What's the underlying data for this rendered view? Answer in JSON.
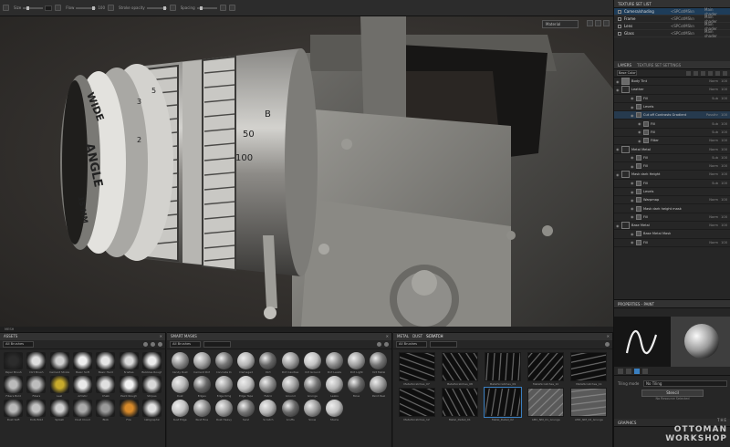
{
  "toolbar": {
    "labels": [
      "Size",
      "Flow",
      "Stroke opacity",
      "Spacing"
    ],
    "values": [
      "1",
      "100",
      "100",
      "1"
    ]
  },
  "viewport": {
    "camera_mode": "Material",
    "status_label": "MESH",
    "lens_engraving_1": "WIDE",
    "lens_engraving_2": "ANGLE",
    "lens_engraving_3": "15 MM",
    "focus_numbers": [
      "2",
      "3",
      "5",
      "B",
      "50",
      "100"
    ]
  },
  "texture_set_list": {
    "title": "TEXTURE SET LIST",
    "rows": [
      {
        "name": "Camera/shading",
        "shader": "<SPCotMSkn",
        "uv": "Main shader",
        "selected": true
      },
      {
        "name": "Frame",
        "shader": "<SPCotMSkn",
        "uv": "Main shader",
        "selected": false
      },
      {
        "name": "Lens",
        "shader": "<SPCotMSkn",
        "uv": "Main shader",
        "selected": false
      },
      {
        "name": "Glass",
        "shader": "<SPCotMSkn",
        "uv": "Main shader",
        "selected": false
      }
    ]
  },
  "layers": {
    "tabs": [
      "LAYERS",
      "TEXTURE SET SETTINGS"
    ],
    "channel": "Base Color",
    "rows": [
      {
        "name": "Body Tint",
        "blend": "Norm",
        "op": "100",
        "level": 1,
        "hl": false
      },
      {
        "name": "Leather",
        "blend": "Norm",
        "op": "100",
        "level": 1,
        "hl": false
      },
      {
        "name": "Fill",
        "blend": "Sub",
        "op": "100",
        "level": 2,
        "hl": false
      },
      {
        "name": "Levels",
        "blend": "",
        "op": "",
        "level": 2,
        "hl": false
      },
      {
        "name": "Cut off Contrasts Gradient",
        "blend": "Passthr",
        "op": "100",
        "level": 2,
        "hl": true
      },
      {
        "name": "Fill",
        "blend": "Sub",
        "op": "100",
        "level": 3,
        "hl": false
      },
      {
        "name": "Fill",
        "blend": "Sub",
        "op": "100",
        "level": 3,
        "hl": false
      },
      {
        "name": "Filter",
        "blend": "Norm",
        "op": "100",
        "level": 3,
        "hl": false
      },
      {
        "name": "Metal Metal",
        "blend": "Norm",
        "op": "100",
        "level": 1,
        "hl": false
      },
      {
        "name": "Fill",
        "blend": "Sub",
        "op": "100",
        "level": 2,
        "hl": false
      },
      {
        "name": "Fill",
        "blend": "Norm",
        "op": "100",
        "level": 2,
        "hl": false
      },
      {
        "name": "Mask dark Height",
        "blend": "Norm",
        "op": "100",
        "level": 1,
        "hl": false
      },
      {
        "name": "Fill",
        "blend": "Sub",
        "op": "100",
        "level": 2,
        "hl": false
      },
      {
        "name": "Levels",
        "blend": "",
        "op": "",
        "level": 2,
        "hl": false
      },
      {
        "name": "Warpmap",
        "blend": "Norm",
        "op": "100",
        "level": 2,
        "hl": false
      },
      {
        "name": "Mask dark height mask",
        "blend": "",
        "op": "",
        "level": 2,
        "hl": false
      },
      {
        "name": "Fill",
        "blend": "Norm",
        "op": "100",
        "level": 2,
        "hl": false
      },
      {
        "name": "Base Metal",
        "blend": "Norm",
        "op": "100",
        "level": 1,
        "hl": false
      },
      {
        "name": "Base Metal Mask",
        "blend": "",
        "op": "",
        "level": 2,
        "hl": false
      },
      {
        "name": "Fill",
        "blend": "Norm",
        "op": "100",
        "level": 2,
        "hl": false
      }
    ]
  },
  "properties": {
    "title": "PROPERTIES - PAINT",
    "tiling_label": "Tiling mode",
    "tiling_value": "No Tiling",
    "stencil_label": "Stencil",
    "stencil_sub": "No Resource Selected",
    "section": "GRAPHICS"
  },
  "watermark": {
    "line1": "THE",
    "line2": "OTTOMAN",
    "line3": "WORKSHOP"
  },
  "assets": {
    "title": "ASSETS",
    "filter": "All Brushes",
    "items": [
      {
        "name": "Paper Brush",
        "color": "#2c2c2c"
      },
      {
        "name": "Dirt Brush",
        "color": "#dedede"
      },
      {
        "name": "Cement Stroke",
        "color": "#cfcfcf"
      },
      {
        "name": "Basic Soft",
        "color": "#f0f0f0"
      },
      {
        "name": "Basic Hard",
        "color": "#e6e6e6"
      },
      {
        "name": "Bristles",
        "color": "#d9d9d9"
      },
      {
        "name": "Bubbles Rough",
        "color": "#ececec"
      },
      {
        "name": "Fibers Bold",
        "color": "#bbbbbb"
      },
      {
        "name": "Fibers",
        "color": "#bdbdbd"
      },
      {
        "name": "Leaf",
        "color": "#c8ab2c"
      },
      {
        "name": "Artistic",
        "color": "#e9e9e9"
      },
      {
        "name": "Chalk",
        "color": "#e0e0e0"
      },
      {
        "name": "Paint Rough",
        "color": "#f2f2f2"
      },
      {
        "name": "Stripes",
        "color": "#d8d8d8"
      },
      {
        "name": "Dust Soft",
        "color": "#b9b9b9"
      },
      {
        "name": "Dots Bold",
        "color": "#c2c2c2"
      },
      {
        "name": "Splash",
        "color": "#d0d0d0"
      },
      {
        "name": "Dust Cloud",
        "color": "#aaaaaa"
      },
      {
        "name": "Blob",
        "color": "#9a9a9a"
      },
      {
        "name": "Fire",
        "color": "#d88a2a"
      },
      {
        "name": "Calligraphic",
        "color": "#e2e2e2"
      }
    ]
  },
  "smart_masks": {
    "title": "SMART MASKS",
    "filter": "All Brushes",
    "items": [
      "Candy Rust",
      "Cement Dirt",
      "Concrete D.",
      "Damaged",
      "Dirt",
      "Dirt Cavities",
      "Dirt Ground",
      "Dirt Leaks",
      "Dirt Light",
      "Dirt Metal",
      "Dust",
      "Edges",
      "Edge Dmg",
      "Edge Tape",
      "Fabric",
      "Ground",
      "Grunge",
      "Leaks",
      "Moss",
      "Paint Peel",
      "Rust Edge",
      "Rust Fine",
      "Rust Heavy",
      "Sand",
      "Scratch",
      "Scuffs",
      "Snow",
      "Stains"
    ]
  },
  "textures": {
    "tabs": [
      "METAL",
      "DUST",
      "SCRATCH"
    ],
    "filter": "All Brushes",
    "items": [
      {
        "name": "MetalScratches_07",
        "selected": false
      },
      {
        "name": "MetalScratches_08",
        "selected": false
      },
      {
        "name": "MetalScratches_09",
        "selected": false
      },
      {
        "name": "MetalScratches_10",
        "selected": false
      },
      {
        "name": "MetalScratches_11",
        "selected": false
      },
      {
        "name": "MetalScratches_12",
        "selected": false
      },
      {
        "name": "Metal_Detail_01",
        "selected": false
      },
      {
        "name": "Metal_Detail_02",
        "selected": true
      },
      {
        "name": "AMC_NM_01_Grunge",
        "selected": false
      },
      {
        "name": "AMC_NM_02_Grunge",
        "selected": false
      }
    ]
  }
}
